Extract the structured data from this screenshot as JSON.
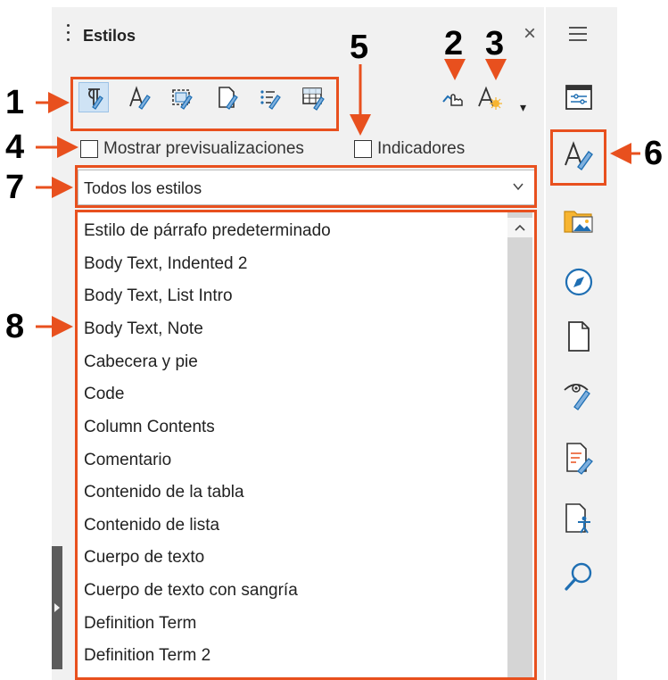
{
  "deck": {
    "title": "Estilos",
    "close_label": "×",
    "menu_label": "≡"
  },
  "toolbar": {
    "style_categories": [
      {
        "name": "paragraph-styles",
        "icon": "paragraph-style-icon",
        "active": true
      },
      {
        "name": "character-styles",
        "icon": "character-style-icon",
        "active": false
      },
      {
        "name": "frame-styles",
        "icon": "frame-style-icon",
        "active": false
      },
      {
        "name": "page-styles",
        "icon": "page-style-icon",
        "active": false
      },
      {
        "name": "list-styles",
        "icon": "list-style-icon",
        "active": false
      },
      {
        "name": "table-styles",
        "icon": "table-style-icon",
        "active": false
      }
    ],
    "fill_format_icon": "fill-format-mode-icon",
    "new_style_icon": "new-style-from-selection-icon",
    "dropdown_arrow": "▾"
  },
  "options": {
    "show_previews_label": "Mostrar previsualizaciones",
    "show_previews_checked": false,
    "indicators_label": "Indicadores",
    "indicators_checked": false
  },
  "filter": {
    "selected": "Todos los estilos"
  },
  "styles_list": [
    "Estilo de párrafo predeterminado",
    "Body Text, Indented 2",
    "Body Text, List Intro",
    "Body Text, Note",
    "Cabecera y pie",
    "Code",
    "Column Contents",
    "Comentario",
    "Contenido de la tabla",
    "Contenido de lista",
    "Cuerpo de texto",
    "Cuerpo de texto con sangría",
    "Definition Term",
    "Definition Term 2"
  ],
  "sidebar_tabs": [
    {
      "name": "properties",
      "icon": "properties-icon",
      "active": false
    },
    {
      "name": "styles",
      "icon": "styles-icon",
      "active": true
    },
    {
      "name": "gallery",
      "icon": "gallery-icon",
      "active": false
    },
    {
      "name": "navigator",
      "icon": "navigator-icon",
      "active": false
    },
    {
      "name": "page",
      "icon": "page-icon",
      "active": false
    },
    {
      "name": "style-inspector",
      "icon": "style-inspector-icon",
      "active": false
    },
    {
      "name": "manage-changes",
      "icon": "manage-changes-icon",
      "active": false
    },
    {
      "name": "accessibility-check",
      "icon": "accessibility-check-icon",
      "active": false
    },
    {
      "name": "find",
      "icon": "find-icon",
      "active": false
    }
  ],
  "callouts": {
    "c1": "1",
    "c2": "2",
    "c3": "3",
    "c4": "4",
    "c5": "5",
    "c6": "6",
    "c7": "7",
    "c8": "8"
  },
  "colors": {
    "accent": "#e8501e",
    "icon_blue": "#1f6fb3",
    "panel_bg": "#f1f1f1",
    "selected_bg": "#cfe3f5"
  }
}
